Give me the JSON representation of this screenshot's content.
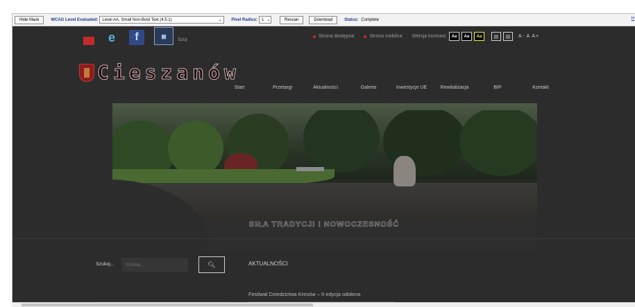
{
  "toolbar": {
    "hide_mask": "Hide Mask",
    "wcag_label": "WCAG Level Evaluated:",
    "wcag_value": "Level AA, Small Non-Bold Text (4.5:1)",
    "pixel_radius_label": "Pixel Radius:",
    "pixel_radius_value": "1",
    "rescan": "Rescan",
    "download": "Download",
    "status_label": "Status:",
    "status_value": "Complete",
    "help": "H"
  },
  "social": {
    "label": "Szuj"
  },
  "access": {
    "item1": "Strona dostępna",
    "item2": "Strona mobilna",
    "contrast_label": "Wersja kontrast:",
    "c1": "Aa",
    "c2": "Aa",
    "c3": "Aa",
    "fontsize": "A- A A+"
  },
  "logo": {
    "text": "Cieszanów"
  },
  "nav": [
    "Start",
    "Przetargi",
    "Aktualności",
    "Galeria",
    "Inwestycje UE",
    "Rewitalizacja",
    "BIP",
    "Kontakt"
  ],
  "tagline": "SIŁA TRADYCJI I NOWOCZESNOŚĆ",
  "search": {
    "label": "Szukaj...",
    "placeholder": "Szukaj..."
  },
  "news": {
    "title": "AKTUALNOŚCI",
    "item": "Festiwal Dziedzictwa Kresów – II edycja odsłona"
  },
  "colors": {
    "background": "#2c2c2c",
    "contrast_yellow": "#ffef3a"
  }
}
